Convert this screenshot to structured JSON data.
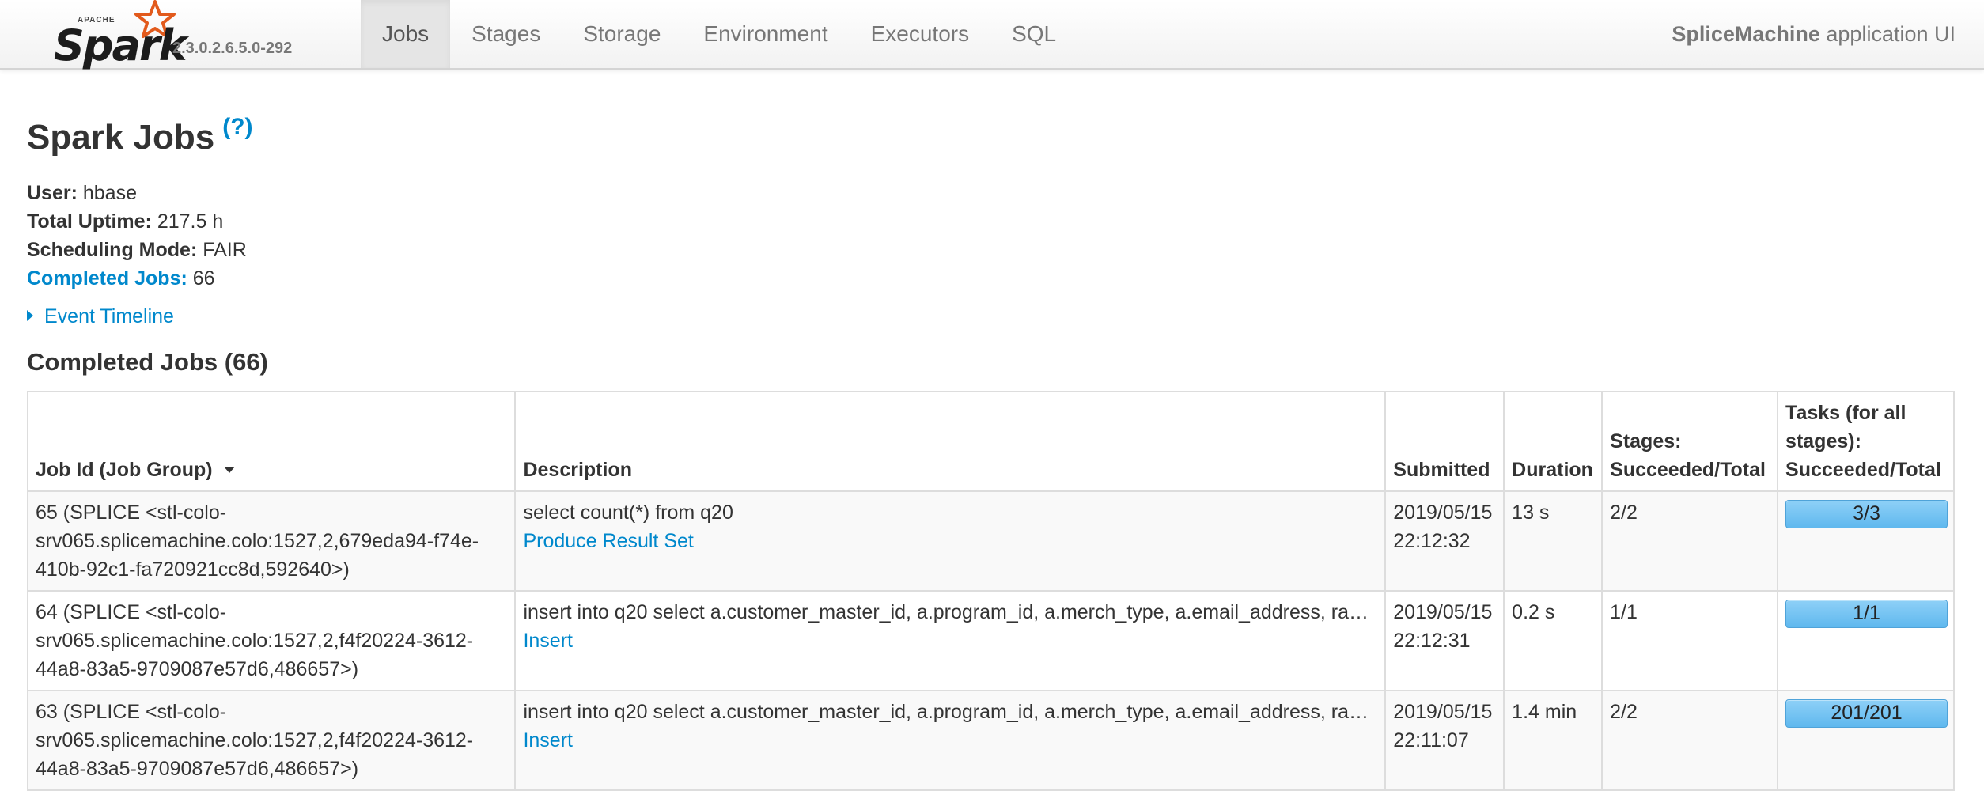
{
  "brand": {
    "apache": "APACHE",
    "spark": "Spark",
    "version": "2.3.0.2.6.5.0-292",
    "accent": "#e25a1c"
  },
  "nav": {
    "tabs": [
      {
        "label": "Jobs",
        "active": true
      },
      {
        "label": "Stages"
      },
      {
        "label": "Storage"
      },
      {
        "label": "Environment"
      },
      {
        "label": "Executors"
      },
      {
        "label": "SQL"
      }
    ],
    "app_name_bold": "SpliceMachine",
    "app_name_rest": " application UI"
  },
  "page": {
    "title": "Spark Jobs",
    "help": "(?)",
    "summary": {
      "user_label": "User:",
      "user": "hbase",
      "uptime_label": "Total Uptime:",
      "uptime": "217.5 h",
      "mode_label": "Scheduling Mode:",
      "mode": "FAIR",
      "completed_label": "Completed Jobs:",
      "completed": "66"
    },
    "event_timeline": "Event Timeline",
    "section_title": "Completed Jobs (66)"
  },
  "table": {
    "headers": {
      "job_id": "Job Id (Job Group)",
      "description": "Description",
      "submitted": "Submitted",
      "duration": "Duration",
      "stages": "Stages: Succeeded/Total",
      "tasks": "Tasks (for all stages): Succeeded/Total"
    },
    "rows": [
      {
        "job_id": "65 (SPLICE <stl-colo-srv065.splicemachine.colo:1527,2,679eda94-f74e-410b-92c1-fa720921cc8d,592640>)",
        "sql": "select count(*) from q20",
        "action": "Produce Result Set",
        "submitted_date": "2019/05/15",
        "submitted_time": "22:12:32",
        "duration": "13 s",
        "stages": "2/2",
        "tasks": "3/3",
        "task_progress": 1.0
      },
      {
        "job_id": "64 (SPLICE <stl-colo-srv065.splicemachine.colo:1527,2,f4f20224-3612-44a8-83a5-9709087e57d6,486657>)",
        "sql": "insert into q20 select a.customer_master_id, a.program_id, a.merch_type, a.email_address, ra…",
        "action": "Insert",
        "submitted_date": "2019/05/15",
        "submitted_time": "22:12:31",
        "duration": "0.2 s",
        "stages": "1/1",
        "tasks": "1/1",
        "task_progress": 1.0
      },
      {
        "job_id": "63 (SPLICE <stl-colo-srv065.splicemachine.colo:1527,2,f4f20224-3612-44a8-83a5-9709087e57d6,486657>)",
        "sql": "insert into q20 select a.customer_master_id, a.program_id, a.merch_type, a.email_address, ra…",
        "action": "Insert",
        "submitted_date": "2019/05/15",
        "submitted_time": "22:11:07",
        "duration": "1.4 min",
        "stages": "2/2",
        "tasks": "201/201",
        "task_progress": 1.0
      }
    ]
  }
}
